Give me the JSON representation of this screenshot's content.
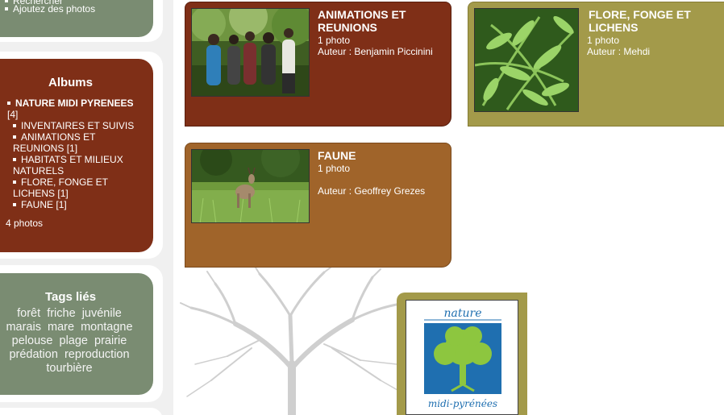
{
  "top_panel": {
    "partial_item": "Rechercher",
    "add_photos": "Ajoutez des photos"
  },
  "albums": {
    "heading": "Albums",
    "root_label": "NATURE MIDI PYRENEES",
    "root_count": "[4]",
    "items": [
      {
        "label": "INVENTAIRES ET SUIVIS",
        "count": ""
      },
      {
        "label": "ANIMATIONS ET REUNIONS",
        "count": "[1]"
      },
      {
        "label": "HABITATS ET MILIEUX NATURELS",
        "count": ""
      },
      {
        "label": "FLORE, FONGE ET LICHENS",
        "count": "[1]"
      },
      {
        "label": "FAUNE",
        "count": "[1]"
      }
    ],
    "total": "4 photos"
  },
  "tags": {
    "heading": "Tags liés",
    "items": [
      "forêt",
      "friche",
      "juvénile",
      "marais",
      "mare",
      "montagne",
      "pelouse",
      "plage",
      "prairie",
      "prédation",
      "reproduction",
      "tourbière"
    ]
  },
  "cards": [
    {
      "title": "ANIMATIONS ET REUNIONS",
      "count": "1 photo",
      "author": "Auteur : Benjamin Piccinini"
    },
    {
      "title": "FLORE, FONGE ET LICHENS",
      "count": "1 photo",
      "author": "Auteur : Mehdi"
    },
    {
      "title": "FAUNE",
      "count": "1 photo",
      "author": "Auteur : Geoffrey Grezes"
    }
  ],
  "logo": {
    "top_text": "nature",
    "bottom_text": "midi-pyrénées"
  },
  "colors": {
    "albums_panel": "#7f2f17",
    "tags_panel": "#7a8c72",
    "card_animations": "#7f2f17",
    "card_flore": "#a39a4a",
    "card_faune": "#a0642a",
    "logo_blue": "#1f6fb0",
    "logo_green": "#8dc63f"
  }
}
